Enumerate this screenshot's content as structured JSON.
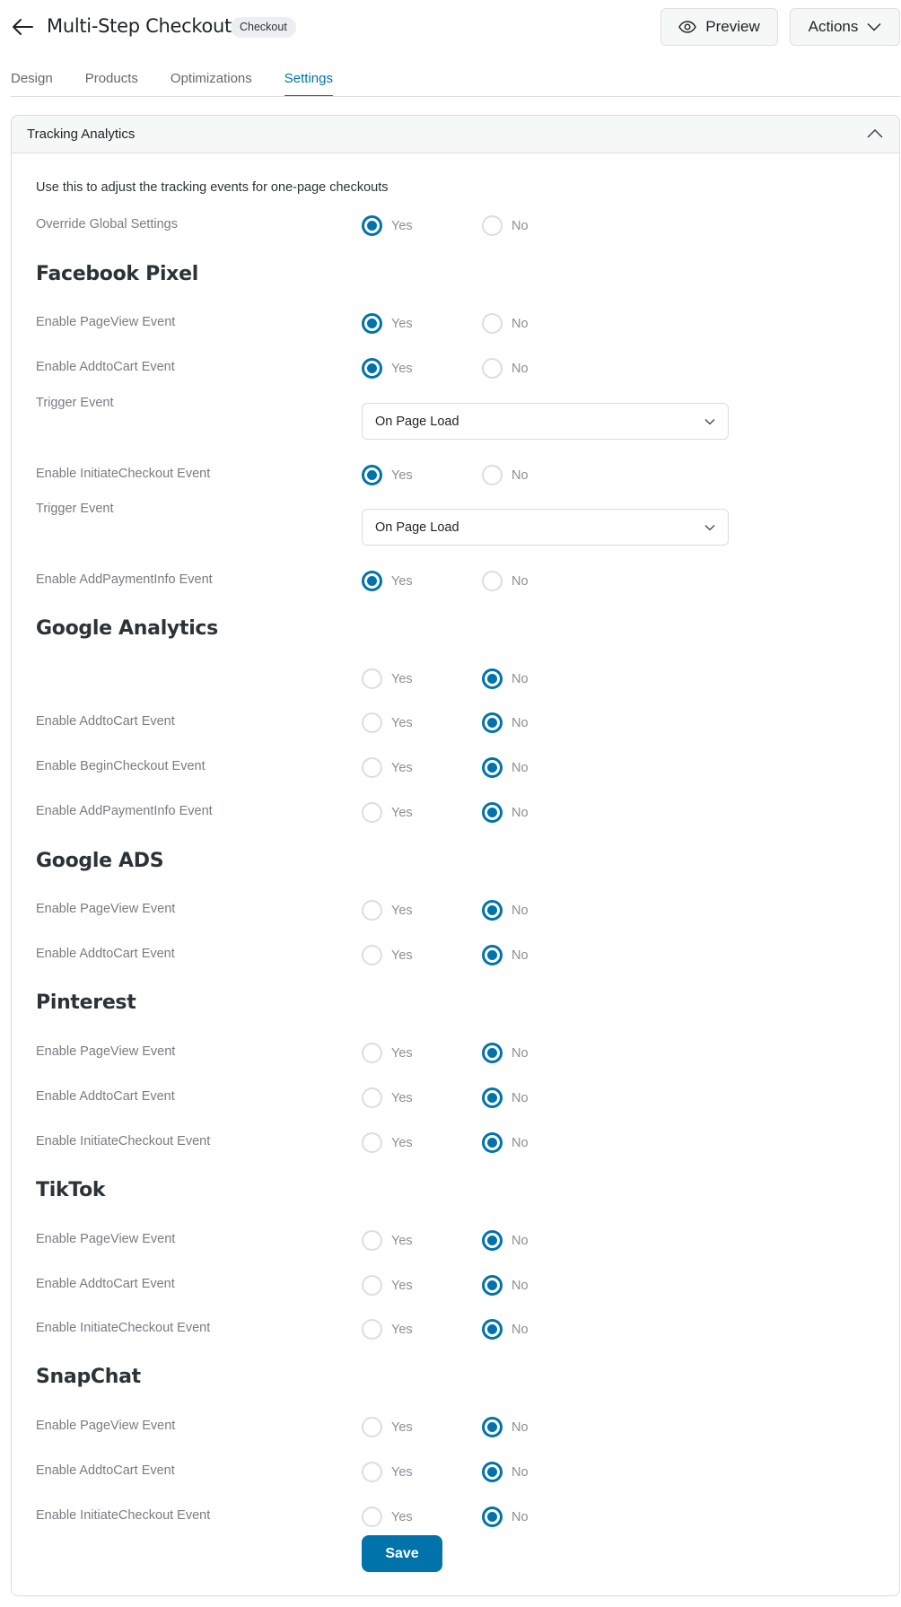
{
  "header": {
    "title": "Multi-Step Checkout",
    "badge": "Checkout",
    "preview_label": "Preview",
    "actions_label": "Actions"
  },
  "tabs": [
    {
      "label": "Design",
      "active": false
    },
    {
      "label": "Products",
      "active": false
    },
    {
      "label": "Optimizations",
      "active": true
    },
    {
      "label": "Settings",
      "active": true
    }
  ],
  "panel": {
    "title": "Tracking Analytics",
    "description": "Use this to adjust the tracking events for one-page checkouts",
    "yes_label": "Yes",
    "no_label": "No",
    "save_label": "Save",
    "override": {
      "label": "Override Global Settings",
      "value": "Yes"
    }
  },
  "sections": [
    {
      "heading": "Facebook Pixel",
      "rows": [
        {
          "type": "radio",
          "label": "Enable PageView Event",
          "value": "Yes"
        },
        {
          "type": "radio",
          "label": "Enable AddtoCart Event",
          "value": "Yes"
        },
        {
          "type": "select",
          "label": "Trigger Event",
          "value": "On Page Load"
        },
        {
          "type": "radio",
          "label": "Enable InitiateCheckout Event",
          "value": "Yes"
        },
        {
          "type": "select",
          "label": "Trigger Event",
          "value": "On Page Load"
        },
        {
          "type": "radio",
          "label": "Enable AddPaymentInfo Event",
          "value": "Yes"
        }
      ]
    },
    {
      "heading": "Google Analytics",
      "rows": [
        {
          "type": "radio",
          "label": "",
          "value": "No"
        },
        {
          "type": "radio",
          "label": "Enable AddtoCart Event",
          "value": "No"
        },
        {
          "type": "radio",
          "label": "Enable BeginCheckout Event",
          "value": "No"
        },
        {
          "type": "radio",
          "label": "Enable AddPaymentInfo Event",
          "value": "No"
        }
      ]
    },
    {
      "heading": "Google ADS",
      "rows": [
        {
          "type": "radio",
          "label": "Enable PageView Event",
          "value": "No"
        },
        {
          "type": "radio",
          "label": "Enable AddtoCart Event",
          "value": "No"
        }
      ]
    },
    {
      "heading": "Pinterest",
      "rows": [
        {
          "type": "radio",
          "label": "Enable PageView Event",
          "value": "No"
        },
        {
          "type": "radio",
          "label": "Enable AddtoCart Event",
          "value": "No"
        },
        {
          "type": "radio",
          "label": "Enable InitiateCheckout Event",
          "value": "No"
        }
      ]
    },
    {
      "heading": "TikTok",
      "rows": [
        {
          "type": "radio",
          "label": "Enable PageView Event",
          "value": "No"
        },
        {
          "type": "radio",
          "label": "Enable AddtoCart Event",
          "value": "No"
        },
        {
          "type": "radio",
          "label": "Enable InitiateCheckout Event",
          "value": "No"
        }
      ]
    },
    {
      "heading": "SnapChat",
      "rows": [
        {
          "type": "radio",
          "label": "Enable PageView Event",
          "value": "No"
        },
        {
          "type": "radio",
          "label": "Enable AddtoCart Event",
          "value": "No"
        },
        {
          "type": "radio",
          "label": "Enable InitiateCheckout Event",
          "value": "No"
        }
      ]
    }
  ],
  "colors": {
    "accent": "#0073aa"
  }
}
